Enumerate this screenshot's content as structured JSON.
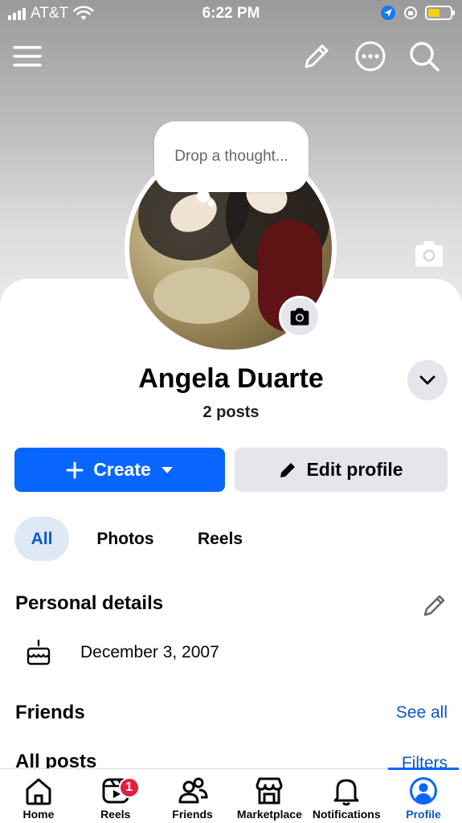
{
  "status_bar": {
    "carrier": "AT&T",
    "time": "6:22 PM",
    "battery_color": "#f5d20a"
  },
  "header_icons": [
    "menu-icon",
    "pencil-icon",
    "more-icon",
    "search-icon"
  ],
  "profile": {
    "thought_placeholder": "Drop a thought...",
    "name": "Angela Duarte",
    "posts_count": "2 posts"
  },
  "actions": {
    "create_label": "Create",
    "edit_profile_label": "Edit profile",
    "accent_color": "#0866ff"
  },
  "filter_tabs": [
    {
      "label": "All",
      "selected": true
    },
    {
      "label": "Photos",
      "selected": false
    },
    {
      "label": "Reels",
      "selected": false
    }
  ],
  "personal_details": {
    "title": "Personal details",
    "birthday": "December 3, 2007"
  },
  "friends": {
    "title": "Friends",
    "see_all": "See all"
  },
  "all_posts": {
    "title": "All posts",
    "filters": "Filters"
  },
  "bottom_nav": [
    {
      "label": "Home",
      "icon": "home-icon",
      "active": false
    },
    {
      "label": "Reels",
      "icon": "reels-icon",
      "active": false,
      "badge": "1"
    },
    {
      "label": "Friends",
      "icon": "friends-icon",
      "active": false
    },
    {
      "label": "Marketplace",
      "icon": "marketplace-icon",
      "active": false
    },
    {
      "label": "Notifications",
      "icon": "bell-icon",
      "active": false
    },
    {
      "label": "Profile",
      "icon": "profile-icon",
      "active": true
    }
  ]
}
